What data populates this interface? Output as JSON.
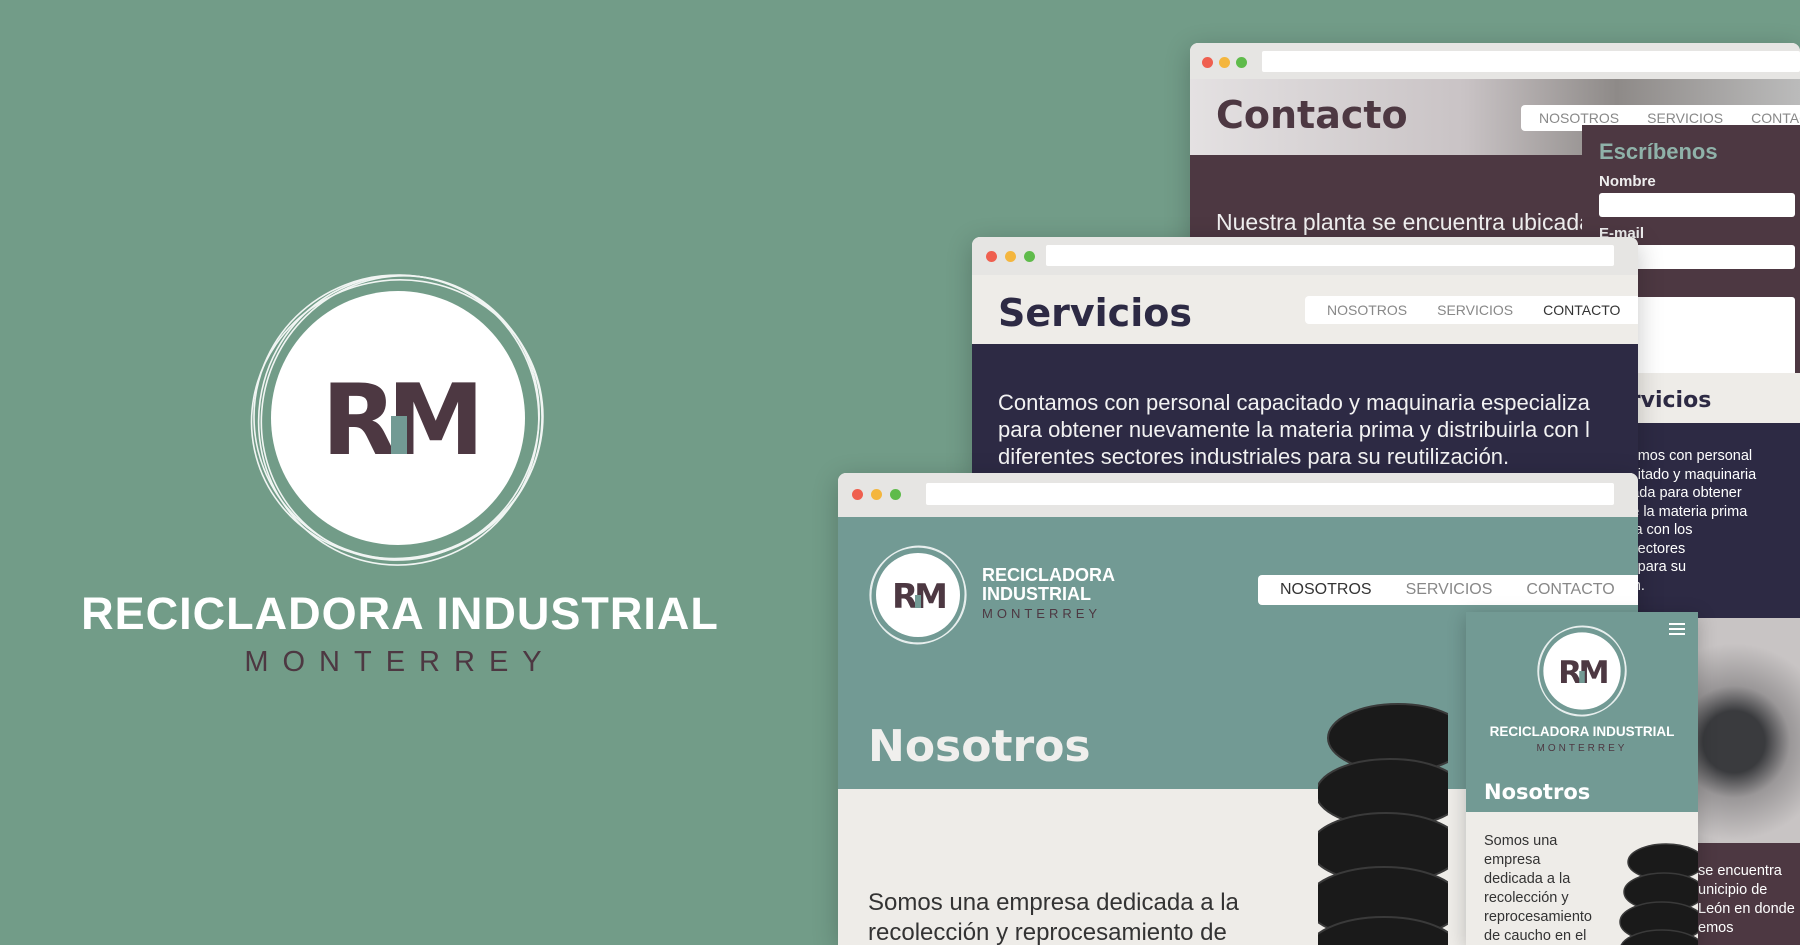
{
  "brand": {
    "monogram_left": "R",
    "monogram_right": "M",
    "name": "RECICLADORA INDUSTRIAL",
    "city": "MONTERREY"
  },
  "colors": {
    "background": "#729c88",
    "plum": "#4d3842",
    "teal": "#729a94",
    "navy": "#2d2a44"
  },
  "nav": {
    "item1": "NOSOTROS",
    "item2": "SERVICIOS",
    "item3": "CONTACTO",
    "item3_cut": "CONTAC"
  },
  "contacto": {
    "title": "Contacto",
    "body": "Nuestra planta se encuentra ubicada e",
    "form_title": "Escríbenos",
    "field_name": "Nombre",
    "field_email": "E-mail",
    "field_message": "aje"
  },
  "servicios": {
    "title": "Servicios",
    "body_l1": "Contamos con personal capacitado y maquinaria especializa",
    "body_l2": "para obtener nuevamente la materia prima y distribuirla con l",
    "body_l3": "diferentes sectores industriales para su reutilización.",
    "mobile_title": "Servicios",
    "mobile_lines": [
      "Contamos con personal",
      "capacitado y maquinaria",
      "cializada para obtener",
      "mente la materia prima",
      "ribuirla con los",
      "ntes sectores",
      "riales para su",
      "zación."
    ]
  },
  "nosotros": {
    "brand_line1": "RECICLADORA",
    "brand_line2": "INDUSTRIAL",
    "brand_line3": "MONTERREY",
    "title": "Nosotros",
    "body_l1": "Somos una empresa dedicada a la",
    "body_l2": "recolección y reprocesamiento de"
  },
  "mobile": {
    "menu_icon": "hamburger-icon",
    "brand": "RECICLADORA INDUSTRIAL",
    "city": "MONTERREY",
    "title": "Nosotros",
    "lines": [
      "Somos una",
      "empresa",
      "dedicada a la",
      "recolección y",
      "reprocesamiento",
      "de caucho en el"
    ],
    "contact_lines": [
      "se encuentra",
      "unicipio de",
      "León en donde",
      "emos"
    ]
  }
}
